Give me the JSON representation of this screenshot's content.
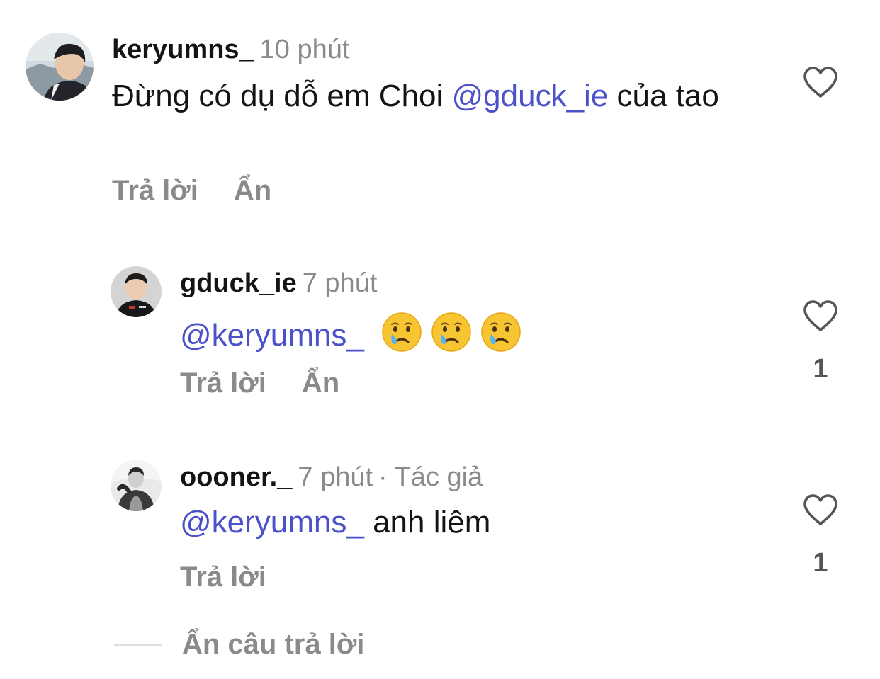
{
  "comments": [
    {
      "username": "keryumns_",
      "time": "10 phút",
      "author_tag": "",
      "text_before": "Đừng có dụ dỗ em Choi ",
      "mention": "@gduck_ie",
      "text_after": " của tao",
      "reply_label": "Trả lời",
      "hide_label": "Ẩn",
      "like_count": ""
    },
    {
      "username": "gduck_ie",
      "time": "7 phút",
      "author_tag": "",
      "mention": "@keryumns_",
      "emojis": [
        "crying-face",
        "crying-face",
        "crying-face"
      ],
      "reply_label": "Trả lời",
      "hide_label": "Ẩn",
      "like_count": "1"
    },
    {
      "username": "oooner._",
      "time": "7 phút",
      "author_tag": "· Tác giả",
      "mention": "@keryumns_",
      "text_after": " anh liêm",
      "reply_label": "Trả lời",
      "like_count": "1"
    }
  ],
  "hide_replies_label": "Ẩn câu trả lời",
  "colors": {
    "mention": "#4a51c9",
    "muted": "#8a8a8a",
    "text": "#141414"
  }
}
